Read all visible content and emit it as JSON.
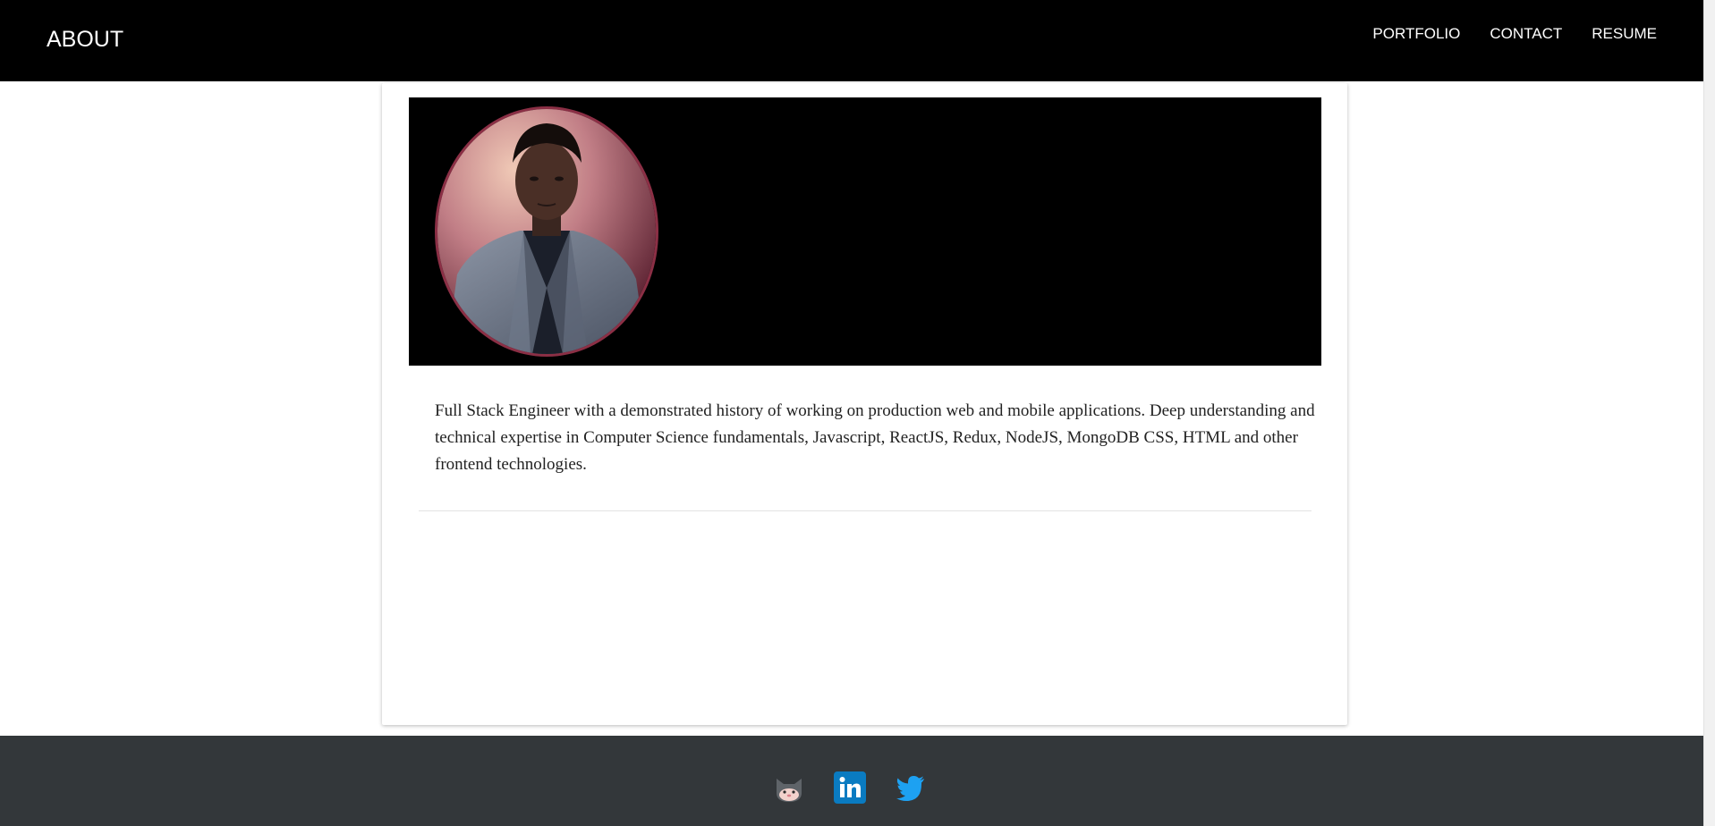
{
  "header": {
    "title": "ABOUT",
    "nav": [
      {
        "label": "PORTFOLIO"
      },
      {
        "label": "CONTACT"
      },
      {
        "label": "RESUME"
      }
    ]
  },
  "profile": {
    "bio": "Full Stack Engineer with a demonstrated history of working on production web and mobile applications. Deep understanding and technical expertise in Computer Science fundamentals, Javascript, ReactJS, Redux, NodeJS, MongoDB CSS, HTML and other frontend technologies."
  },
  "footer": {
    "social": [
      {
        "icon": "github-icon"
      },
      {
        "icon": "linkedin-icon"
      },
      {
        "icon": "twitter-icon"
      }
    ]
  },
  "colors": {
    "header_bg": "#000000",
    "footer_bg": "#33373a",
    "linkedin": "#0a7bc1",
    "twitter": "#1da1f2",
    "avatar_border": "#8b2f45"
  }
}
